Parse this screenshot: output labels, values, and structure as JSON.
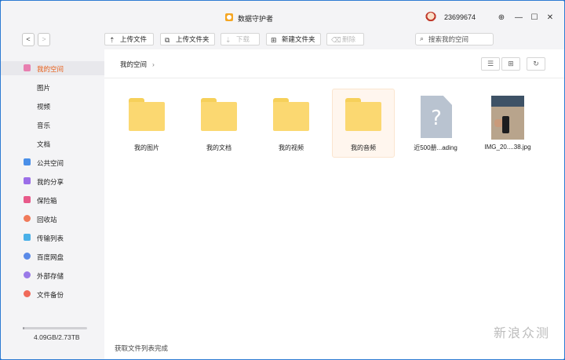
{
  "app": {
    "title": "数据守护者",
    "username": "23699674"
  },
  "window_controls": [
    "pin",
    "minimize",
    "maximize",
    "close"
  ],
  "toolbar": {
    "back_label": "<",
    "forward_label": ">",
    "upload_file": "上传文件",
    "upload_folder": "上传文件夹",
    "download": "下载",
    "new_folder": "新建文件夹",
    "delete": "删除",
    "search_placeholder": "搜索我的空间"
  },
  "sidebar": {
    "items": [
      {
        "label": "我的空间",
        "icon": "my-space-icon",
        "color": "#e87fb0",
        "active": true
      },
      {
        "label": "图片",
        "sub": true
      },
      {
        "label": "视频",
        "sub": true
      },
      {
        "label": "音乐",
        "sub": true
      },
      {
        "label": "文档",
        "sub": true
      },
      {
        "label": "公共空间",
        "icon": "public-space-icon",
        "color": "#4a8fe8"
      },
      {
        "label": "我的分享",
        "icon": "share-icon",
        "color": "#9b6ee8"
      },
      {
        "label": "保险箱",
        "icon": "safe-icon",
        "color": "#e85a8a"
      },
      {
        "label": "回收站",
        "icon": "trash-icon",
        "color": "#f07a5a"
      },
      {
        "label": "传输列表",
        "icon": "transfer-icon",
        "color": "#4ab0e8"
      },
      {
        "label": "百度网盘",
        "icon": "baidu-cloud-icon",
        "color": "#5a8ae8"
      },
      {
        "label": "外部存储",
        "icon": "external-storage-icon",
        "color": "#9a7ae8"
      },
      {
        "label": "文件备份",
        "icon": "backup-icon",
        "color": "#f06a5a"
      }
    ],
    "storage_text": "4.09GB/2.73TB",
    "storage_fraction": 0.0015
  },
  "main": {
    "breadcrumb": "我的空间",
    "files": [
      {
        "name": "我的图片",
        "type": "folder"
      },
      {
        "name": "我的文档",
        "type": "folder"
      },
      {
        "name": "我的视频",
        "type": "folder"
      },
      {
        "name": "我的音频",
        "type": "folder",
        "selected": true
      },
      {
        "name": "近500册...ading",
        "type": "unknown"
      },
      {
        "name": "IMG_20....38.jpg",
        "type": "image"
      }
    ],
    "status": "获取文件列表完成"
  },
  "watermark": "新浪众测"
}
